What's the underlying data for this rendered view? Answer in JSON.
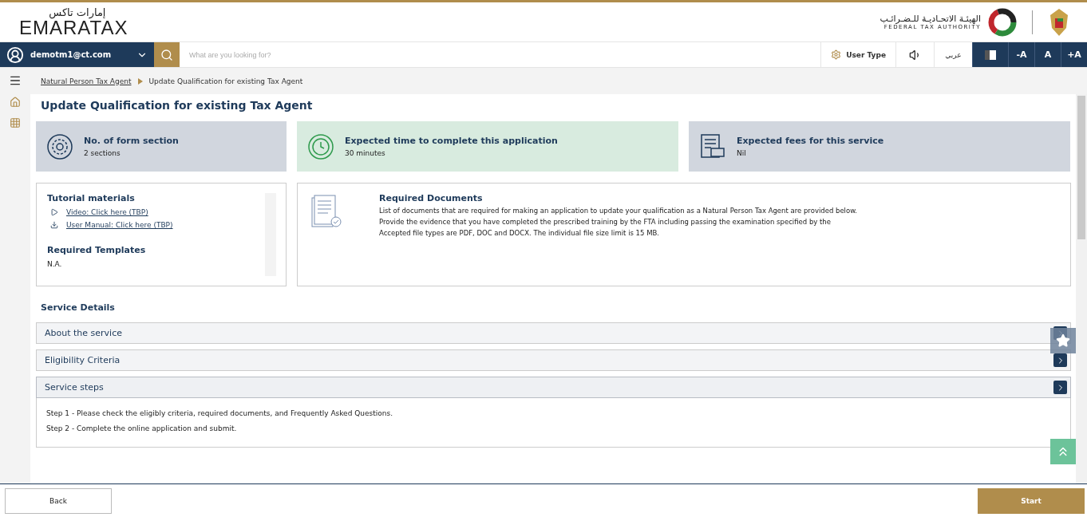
{
  "header": {
    "logo_arabic": "إمارات تاكس",
    "logo_text": "EMARATAX",
    "authority_arabic": "الهيئـة الاتحـاديـة للـضـرائـب",
    "authority_english": "FEDERAL TAX AUTHORITY"
  },
  "navbar": {
    "user": "demotm1@ct.com",
    "search_placeholder": "What are you looking for?",
    "user_type": "User Type",
    "language": "عربي",
    "font_buttons": [
      "-A",
      "A",
      "+A"
    ]
  },
  "breadcrumb": [
    {
      "label": "Natural Person Tax Agent",
      "link": true
    },
    {
      "label": "Update Qualification for existing Tax Agent",
      "link": false
    }
  ],
  "page_title": "Update Qualification for existing Tax Agent",
  "info_cards": [
    {
      "kind": "sections",
      "title": "No. of form section",
      "value": "2 sections"
    },
    {
      "kind": "time",
      "title": "Expected time to complete this application",
      "value": "30 minutes"
    },
    {
      "kind": "fees",
      "title": "Expected fees for this service",
      "value": "Nil"
    }
  ],
  "tutorial": {
    "title": "Tutorial materials",
    "links": [
      {
        "kind": "video",
        "label": "Video: Click here (TBP)"
      },
      {
        "kind": "download",
        "label": "User Manual: Click here (TBP)"
      }
    ],
    "templates_title": "Required Templates",
    "templates_value": "N.A."
  },
  "required_documents": {
    "title": "Required Documents",
    "lines": [
      "List of documents that are required for making an application to update your qualification as a Natural Person Tax Agent are provided below.",
      "Provide the evidence that you have completed the prescribed training by the FTA including passing the examination specified by the",
      "Accepted file types are PDF, DOC and DOCX. The individual file size limit is 15 MB."
    ]
  },
  "service_details": {
    "title": "Service Details",
    "sections": [
      {
        "label": "About the service",
        "expanded": false
      },
      {
        "label": "Eligibility Criteria",
        "expanded": false
      },
      {
        "label": "Service steps",
        "expanded": true,
        "lines": [
          "Step 1 - Please check the eligibly criteria, required documents, and Frequently Asked Questions.",
          "Step 2 - Complete the online application and submit."
        ]
      }
    ]
  },
  "footer": {
    "back": "Back",
    "start": "Start"
  }
}
